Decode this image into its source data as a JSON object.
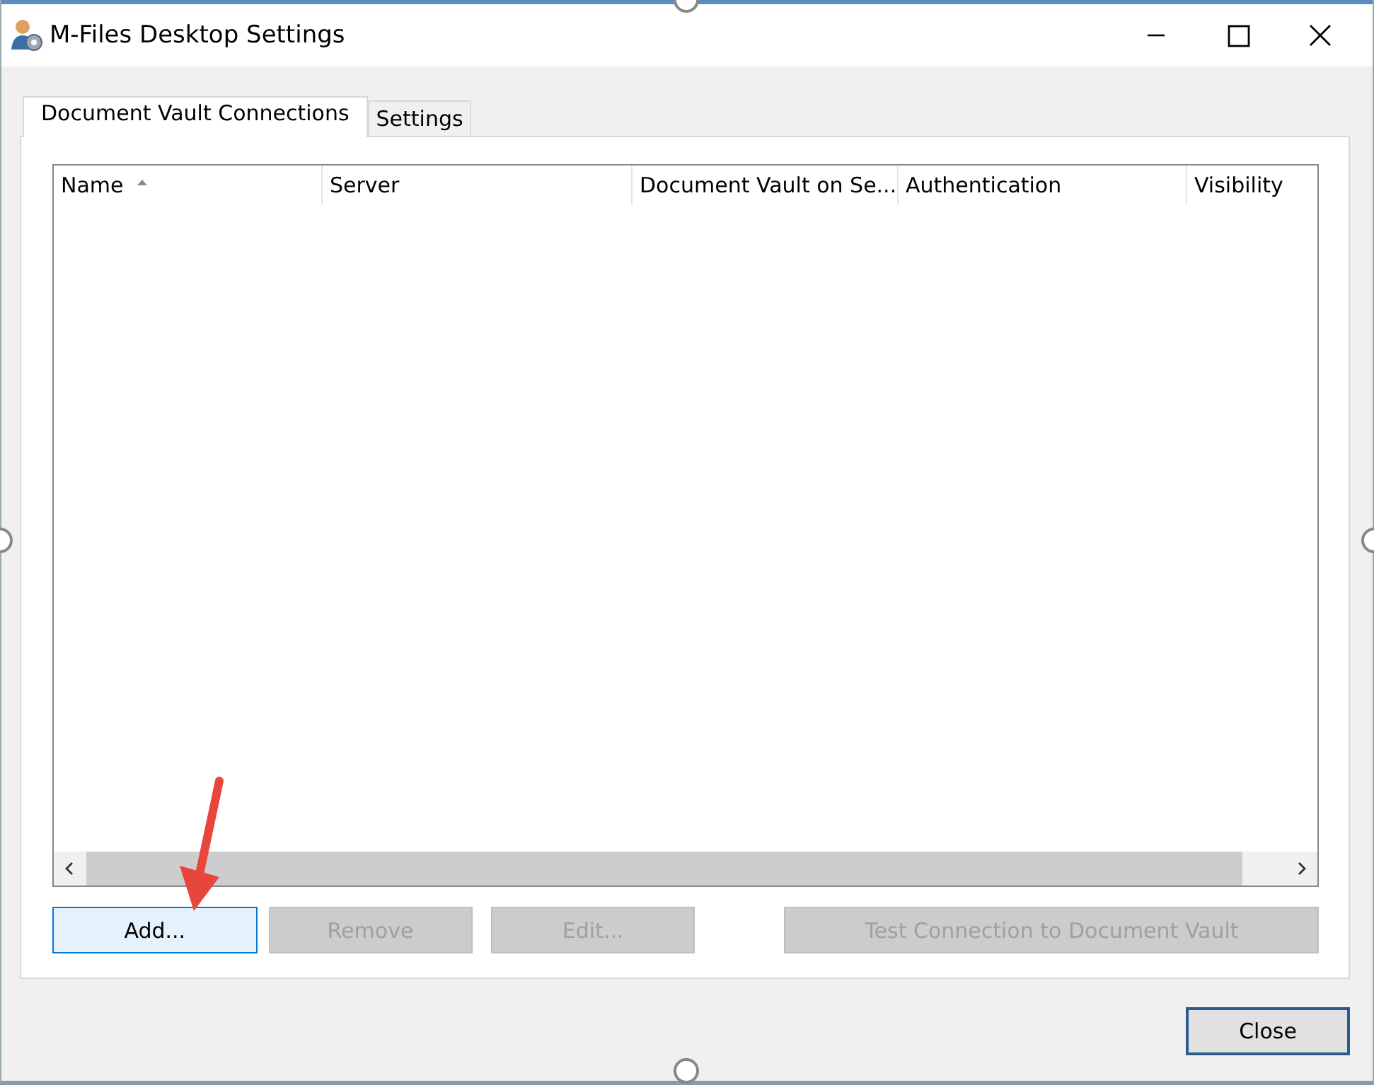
{
  "window": {
    "title": "M-Files Desktop Settings"
  },
  "tabs": [
    {
      "label": "Document Vault Connections",
      "selected": true
    },
    {
      "label": "Settings",
      "selected": false
    }
  ],
  "table": {
    "columns": [
      {
        "label": "Name",
        "sorted": true
      },
      {
        "label": "Server",
        "sorted": false
      },
      {
        "label": "Document Vault on Se...",
        "sorted": false
      },
      {
        "label": "Authentication",
        "sorted": false
      },
      {
        "label": "Visibility",
        "sorted": false
      }
    ]
  },
  "buttons": [
    {
      "label": "Add...",
      "disabled": false,
      "focused": true
    },
    {
      "label": "Remove",
      "disabled": true,
      "focused": false
    },
    {
      "label": "Edit...",
      "disabled": true,
      "focused": false
    },
    {
      "label": "Test Connection to Document Vault",
      "disabled": true,
      "focused": false
    }
  ],
  "footer_buttons": [
    {
      "label": "Close",
      "default": true
    }
  ]
}
